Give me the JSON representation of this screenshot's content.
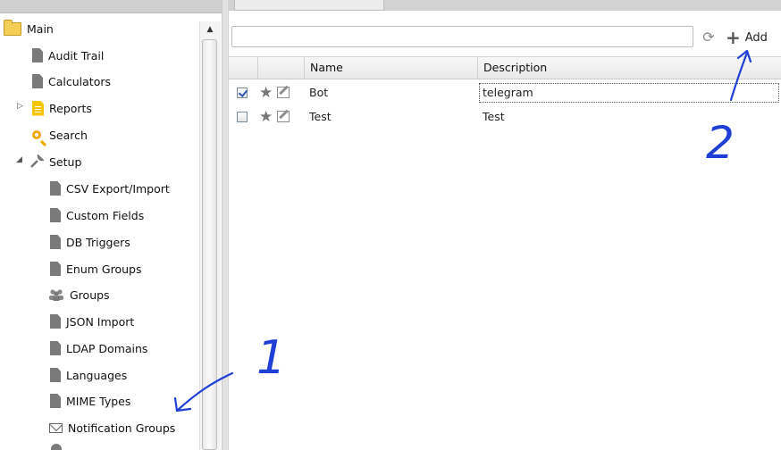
{
  "sidebar": {
    "items": [
      {
        "label": "Main",
        "icon": "folder-icon"
      },
      {
        "label": "Audit Trail",
        "icon": "document-icon"
      },
      {
        "label": "Calculators",
        "icon": "document-icon"
      },
      {
        "label": "Reports",
        "icon": "reports-icon"
      },
      {
        "label": "Search",
        "icon": "search-icon"
      },
      {
        "label": "Setup",
        "icon": "wrench-icon"
      },
      {
        "label": "CSV Export/Import",
        "icon": "document-icon"
      },
      {
        "label": "Custom Fields",
        "icon": "document-icon"
      },
      {
        "label": "DB Triggers",
        "icon": "document-icon"
      },
      {
        "label": "Enum Groups",
        "icon": "document-icon"
      },
      {
        "label": "Groups",
        "icon": "groups-icon"
      },
      {
        "label": "JSON Import",
        "icon": "document-icon"
      },
      {
        "label": "LDAP Domains",
        "icon": "document-icon"
      },
      {
        "label": "Languages",
        "icon": "document-icon"
      },
      {
        "label": "MIME Types",
        "icon": "document-icon"
      },
      {
        "label": "Notification Groups",
        "icon": "envelope-icon"
      }
    ]
  },
  "toolbar": {
    "search_value": "",
    "search_placeholder": "",
    "add_label": "Add",
    "refresh_icon": "refresh-icon"
  },
  "grid": {
    "columns": [
      "Name",
      "Description"
    ],
    "rows": [
      {
        "checked": true,
        "name": "Bot",
        "description": "telegram"
      },
      {
        "checked": false,
        "name": "Test",
        "description": "Test"
      }
    ]
  },
  "annotations": {
    "label_1": "1",
    "label_2": "2",
    "color": "#1f3fd6"
  }
}
